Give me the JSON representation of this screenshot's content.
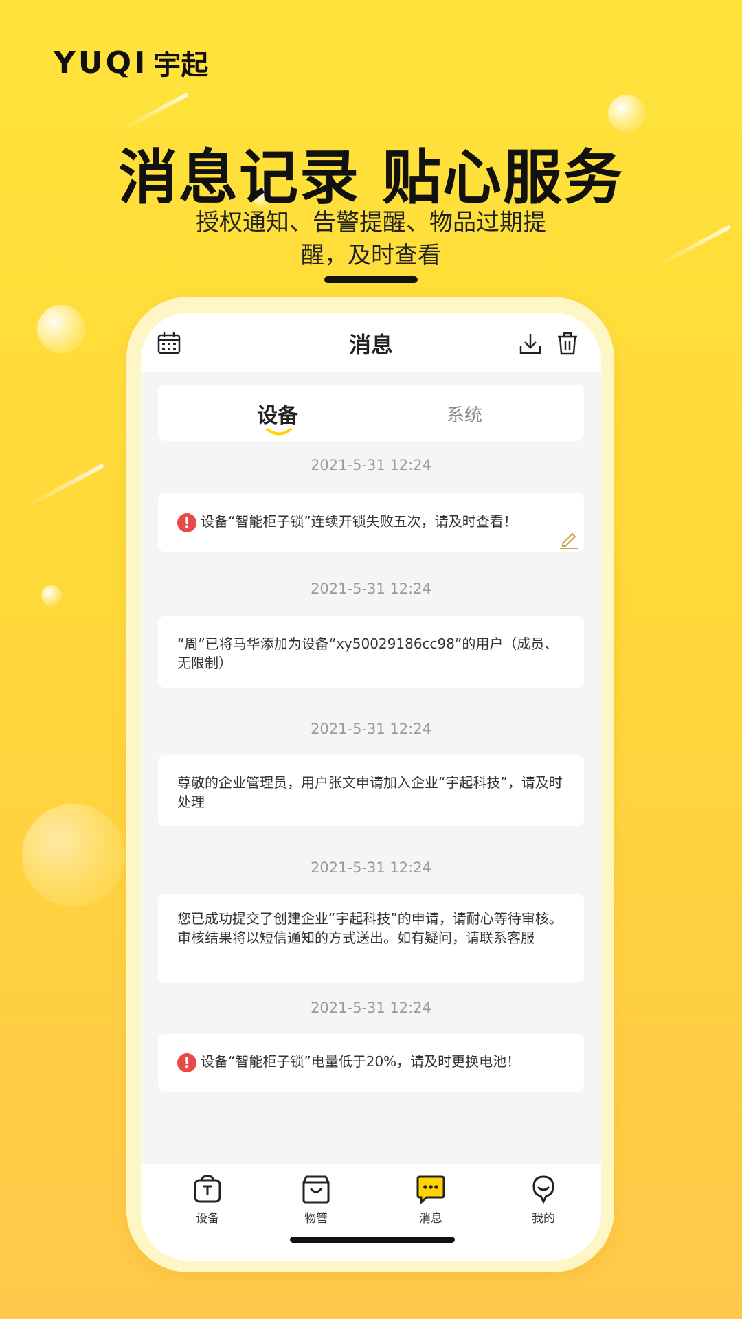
{
  "brand": {
    "logo_text": "YUQI",
    "logo_cn": "宇起"
  },
  "hero": {
    "headline": "消息记录 贴心服务",
    "subline_1": "授权通知、告警提醒、物品过期提",
    "subline_2": "醒，及时查看"
  },
  "app": {
    "title": "消息",
    "header_icons": [
      "calendar-icon",
      "download-icon",
      "trash-icon"
    ],
    "tabs": [
      {
        "label": "设备",
        "active": true
      },
      {
        "label": "系统",
        "active": false
      }
    ],
    "messages": [
      {
        "time": "2021-5-31  12:24",
        "text": "设备“智能柜子锁”连续开锁失败五次，请及时查看！",
        "alert": true,
        "edit_icon": true
      },
      {
        "time": "2021-5-31  12:24",
        "text": "“周”已将马华添加为设备“xy50029186cc98”的用户（成员、无限制）",
        "alert": false
      },
      {
        "time": "2021-5-31  12:24",
        "text": "尊敬的企业管理员，用户张文申请加入企业“宇起科技”，请及时处理",
        "alert": false
      },
      {
        "time": "2021-5-31  12:24",
        "text": "您已成功提交了创建企业“宇起科技”的申请，请耐心等待审核。审核结果将以短信通知的方式送出。如有疑问，请联系客服",
        "alert": false
      },
      {
        "time": "2021-5-31  12:24",
        "text": "设备“智能柜子锁”电量低于20%，请及时更换电池！",
        "alert": true
      }
    ],
    "nav": [
      {
        "label": "设备",
        "icon": "device-icon",
        "active": false
      },
      {
        "label": "物管",
        "icon": "bag-icon",
        "active": false
      },
      {
        "label": "消息",
        "icon": "message-icon",
        "active": true
      },
      {
        "label": "我的",
        "icon": "profile-icon",
        "active": false
      }
    ]
  },
  "colors": {
    "accent": "#FFD400",
    "alert": "#E84A4A",
    "background": "#FFE33B"
  }
}
